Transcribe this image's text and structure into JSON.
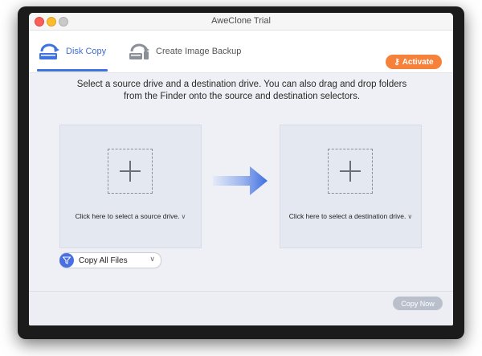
{
  "window": {
    "title": "AweClone Trial"
  },
  "toolbar": {
    "tabs": [
      {
        "label": "Disk Copy",
        "icon": "disk-copy-icon",
        "active": true
      },
      {
        "label": "Create Image Backup",
        "icon": "image-backup-icon",
        "active": false
      }
    ],
    "activate_label": "Activate",
    "activate_icon": "key-icon"
  },
  "main": {
    "instructions_line1": "Select a source drive and a destination drive. You can also drag and drop folders",
    "instructions_line2": "from the Finder onto the source and destination selectors.",
    "source_label": "Click here to select a source drive.",
    "destination_label": "Click here to select a destination drive.",
    "filter_value": "Copy All Files"
  },
  "footer": {
    "copy_now_label": "Copy Now"
  },
  "colors": {
    "accent": "#3e72e0",
    "activate": "#f5813b",
    "arrow": "#3f6fe0"
  }
}
